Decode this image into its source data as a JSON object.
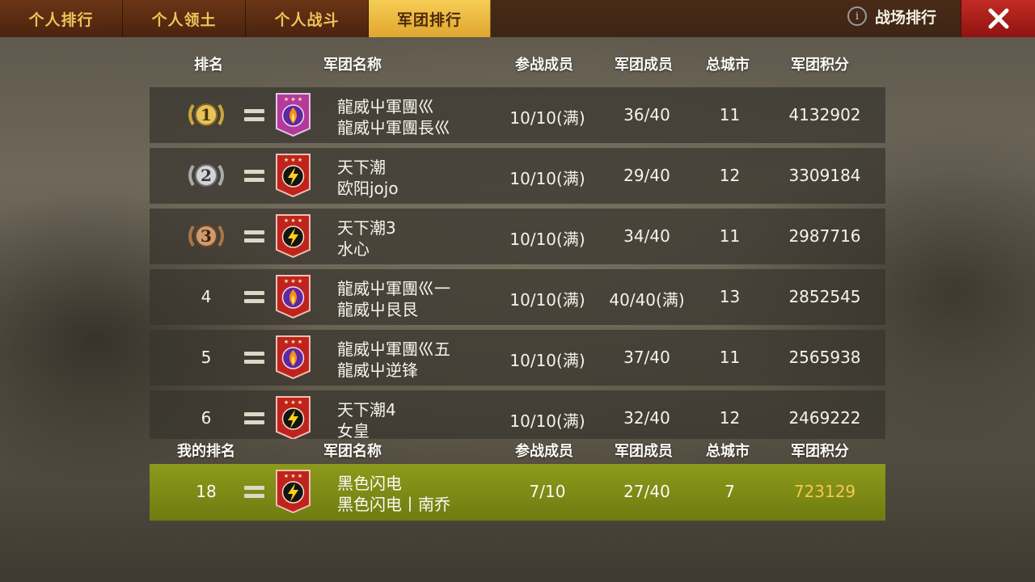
{
  "tabs": [
    {
      "label": "个人排行",
      "active": false
    },
    {
      "label": "个人领土",
      "active": false
    },
    {
      "label": "个人战斗",
      "active": false
    },
    {
      "label": "军团排行",
      "active": true
    }
  ],
  "battlefield": {
    "info_icon": "info-icon",
    "label": "战场排行"
  },
  "close": {
    "icon": "close-icon"
  },
  "headers": {
    "rank": "排名",
    "name": "军团名称",
    "participants": "参战成员",
    "members": "军团成员",
    "cities": "总城市",
    "score": "军团积分"
  },
  "my_headers": {
    "rank": "我的排名",
    "name": "军团名称",
    "participants": "参战成员",
    "members": "军团成员",
    "cities": "总城市",
    "score": "军团积分"
  },
  "rows": [
    {
      "rank": "1",
      "medal": "gold",
      "trend": "=",
      "emblem": "purple-fire",
      "name": "龍威屮軍團巛",
      "leader": "龍威屮軍團長巛",
      "participants": "10/10(满)",
      "members": "36/40",
      "cities": "11",
      "score": "4132902"
    },
    {
      "rank": "2",
      "medal": "silver",
      "trend": "=",
      "emblem": "red-lightning",
      "name": "天下潮",
      "leader": "欧阳jojo",
      "participants": "10/10(满)",
      "members": "29/40",
      "cities": "12",
      "score": "3309184"
    },
    {
      "rank": "3",
      "medal": "bronze",
      "trend": "=",
      "emblem": "red-lightning",
      "name": "天下潮3",
      "leader": "水心",
      "participants": "10/10(满)",
      "members": "34/40",
      "cities": "11",
      "score": "2987716"
    },
    {
      "rank": "4",
      "medal": "",
      "trend": "=",
      "emblem": "red-fire",
      "name": "龍威屮軍團巛一",
      "leader": "龍威屮艮艮",
      "participants": "10/10(满)",
      "members": "40/40(满)",
      "cities": "13",
      "score": "2852545"
    },
    {
      "rank": "5",
      "medal": "",
      "trend": "=",
      "emblem": "red-fire",
      "name": "龍威屮軍團巛五",
      "leader": "龍威屮逆锋",
      "participants": "10/10(满)",
      "members": "37/40",
      "cities": "11",
      "score": "2565938"
    },
    {
      "rank": "6",
      "medal": "",
      "trend": "=",
      "emblem": "red-lightning",
      "name": "天下潮4",
      "leader": "女皇",
      "participants": "10/10(满)",
      "members": "32/40",
      "cities": "12",
      "score": "2469222"
    }
  ],
  "my_row": {
    "rank": "18",
    "trend": "=",
    "emblem": "red-lightning",
    "name": "黑色闪电",
    "leader": "黑色闪电丨南乔",
    "participants": "7/10",
    "members": "27/40",
    "cities": "7",
    "score": "723129"
  },
  "colors": {
    "score": "#f2c13f",
    "tab_active": "#f0bf46",
    "tab_text": "#f1c257",
    "my_row": "#7f8c16",
    "close": "#b0221c"
  }
}
